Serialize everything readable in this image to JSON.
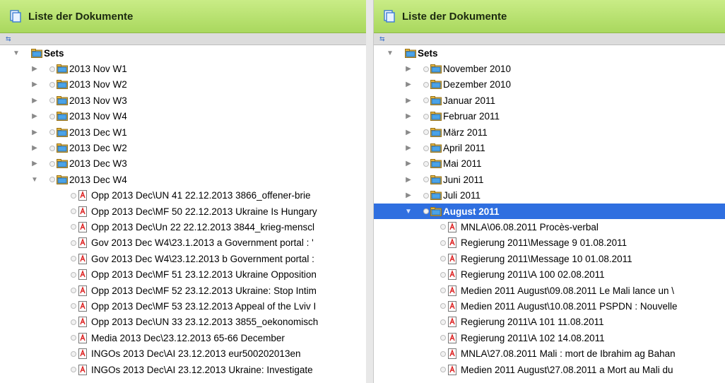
{
  "left": {
    "header_title": "Liste der Dokumente",
    "root_label": "Sets",
    "folders": [
      "2013 Nov W1",
      "2013 Nov W2",
      "2013 Nov W3",
      "2013 Nov W4",
      "2013 Dec W1",
      "2013 Dec W2",
      "2013 Dec W3",
      "2013 Dec W4"
    ],
    "docs": [
      "Opp 2013 Dec\\UN 41 22.12.2013  3866_offener-brie",
      "Opp 2013 Dec\\MF 50 22.12.2013 Ukraine Is Hungary",
      "Opp 2013 Dec\\Un 22 22.12.2013 3844_krieg-menscl",
      "Gov 2013 Dec W4\\23.1.2013 a Government portal : '",
      "Gov 2013 Dec W4\\23.12.2013 b Government portal :",
      "Opp 2013 Dec\\MF 51 23.12.2013 Ukraine Opposition",
      "Opp 2013 Dec\\MF 52 23.12.2013 Ukraine: Stop Intim",
      "Opp 2013 Dec\\MF 53 23.12.2013 Appeal of the Lviv I",
      "Opp 2013 Dec\\UN 33 23.12.2013 3855_oekonomisch",
      "Media 2013 Dec\\23.12.2013 65-66 December",
      "INGOs 2013 Dec\\AI 23.12.2013 eur500202013en",
      "INGOs 2013 Dec\\AI 23.12.2013 Ukraine: Investigate"
    ]
  },
  "right": {
    "header_title": "Liste der Dokumente",
    "root_label": "Sets",
    "folders": [
      "November 2010",
      "Dezember 2010",
      "Januar 2011",
      "Februar 2011",
      "März 2011",
      "April 2011",
      "Mai 2011",
      "Juni 2011",
      "Juli 2011",
      "August 2011"
    ],
    "selected_folder_index": 9,
    "docs": [
      "MNLA\\06.08.2011 Procès-verbal",
      "Regierung 2011\\Message 9 01.08.2011",
      "Regierung 2011\\Message 10 01.08.2011",
      "Regierung 2011\\A 100 02.08.2011",
      "Medien 2011 August\\09.08.2011 Le Mali lance un \\",
      "Medien 2011 August\\10.08.2011 PSPDN : Nouvelle",
      "Regierung 2011\\A 101 11.08.2011",
      "Regierung 2011\\A 102 14.08.2011",
      "MNLA\\27.08.2011 Mali : mort de Ibrahim ag Bahan",
      "Medien 2011 August\\27.08.2011 a Mort au Mali du"
    ]
  },
  "icons": {
    "header": "document-list-icon",
    "toolbar": "link-icon",
    "folder": "folder-set-icon",
    "pdf": "pdf-document-icon"
  },
  "colors": {
    "header_green": "#b6e06e",
    "selection_blue": "#2f6fe0"
  }
}
